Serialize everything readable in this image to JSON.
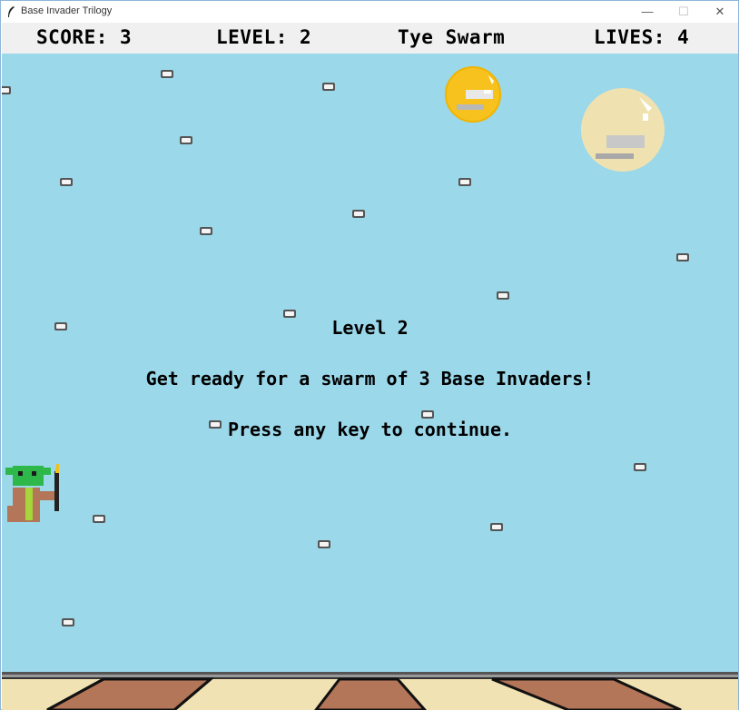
{
  "window": {
    "title": "Base Invader Trilogy",
    "minimize": "—",
    "maximize": "☐",
    "close": "✕"
  },
  "hud": {
    "score": "SCORE: 3",
    "level": "LEVEL: 2",
    "enemy": "Tye Swarm",
    "lives": "LIVES: 4"
  },
  "message": {
    "line1": "Level 2",
    "line2": "Get ready for a swarm of 3 Base Invaders!",
    "line3": "Press any key to continue."
  },
  "colors": {
    "sky": "#9ad8ea",
    "hud_bg": "#f0f0f0",
    "sun": "#f8c21e",
    "moon": "#efe2b0",
    "ground_sand": "#f1e2b4",
    "ground_brown": "#b37658"
  },
  "icons": {
    "player": "green-alien-wizard-sprite",
    "stars": "grey-rock-star-icon"
  }
}
